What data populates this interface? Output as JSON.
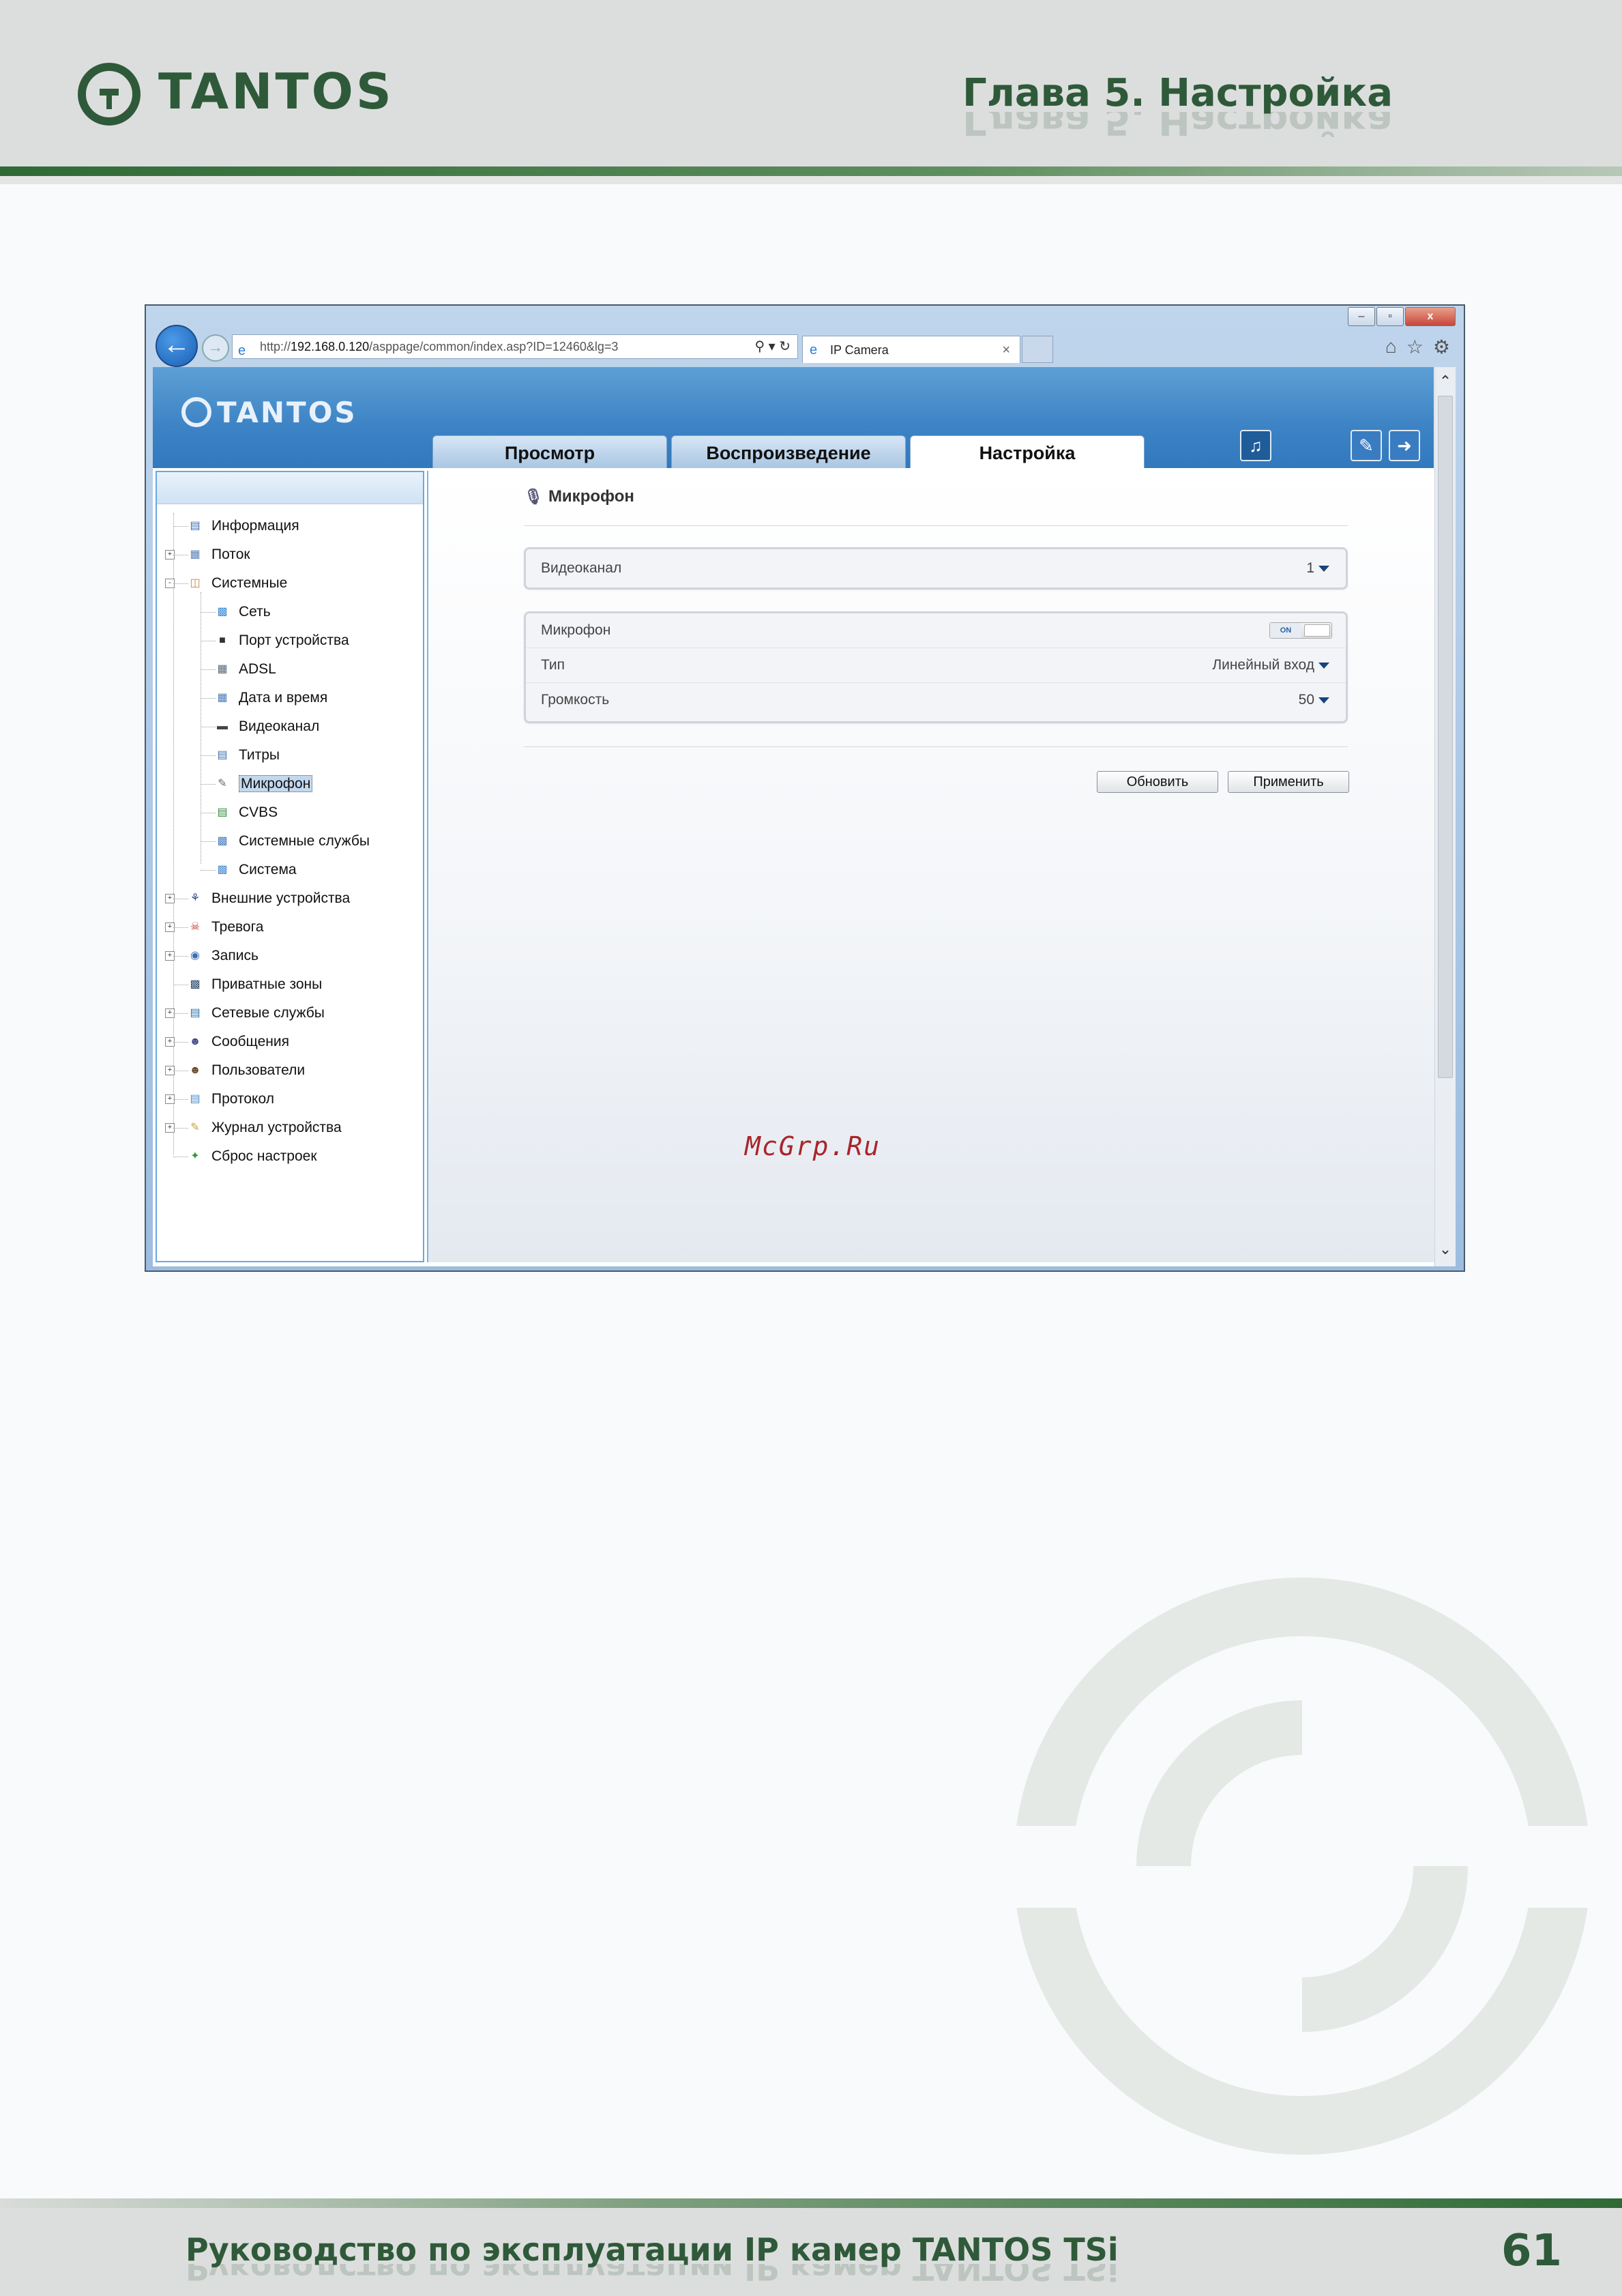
{
  "header": {
    "logo_text": "TANTOS",
    "chapter": "Глава 5. Настройка"
  },
  "browser": {
    "address_prefix": "http://",
    "address_host": "192.168.0.120",
    "address_path": "/asppage/common/index.asp?ID=12460&lg=3",
    "tab_title": "IP Camera",
    "window_buttons": [
      "–",
      "▫",
      "x"
    ]
  },
  "app": {
    "logo_text": "TANTOS",
    "tabs": [
      "Просмотр",
      "Воспроизведение",
      "Настройка"
    ],
    "active_tab": "Настройка",
    "sidebar": [
      {
        "label": "Информация",
        "icon": "info-icon",
        "level": 0,
        "expander": ""
      },
      {
        "label": "Поток",
        "icon": "stream-icon",
        "level": 0,
        "expander": "+"
      },
      {
        "label": "Системные",
        "icon": "system-folder-icon",
        "level": 0,
        "expander": "-"
      },
      {
        "label": "Сеть",
        "icon": "network-icon",
        "level": 1,
        "expander": ""
      },
      {
        "label": "Порт устройства",
        "icon": "port-icon",
        "level": 1,
        "expander": ""
      },
      {
        "label": "ADSL",
        "icon": "adsl-icon",
        "level": 1,
        "expander": ""
      },
      {
        "label": "Дата и время",
        "icon": "calendar-icon",
        "level": 1,
        "expander": ""
      },
      {
        "label": "Видеоканал",
        "icon": "camera-icon",
        "level": 1,
        "expander": ""
      },
      {
        "label": "Титры",
        "icon": "titles-icon",
        "level": 1,
        "expander": ""
      },
      {
        "label": "Микрофон",
        "icon": "microphone-icon",
        "level": 1,
        "expander": "",
        "selected": true
      },
      {
        "label": "CVBS",
        "icon": "cvbs-icon",
        "level": 1,
        "expander": ""
      },
      {
        "label": "Системные службы",
        "icon": "services-icon",
        "level": 1,
        "expander": ""
      },
      {
        "label": "Система",
        "icon": "computer-icon",
        "level": 1,
        "expander": ""
      },
      {
        "label": "Внешние устройства",
        "icon": "external-devices-icon",
        "level": 0,
        "expander": "+"
      },
      {
        "label": "Тревога",
        "icon": "alarm-icon",
        "level": 0,
        "expander": "+"
      },
      {
        "label": "Запись",
        "icon": "record-icon",
        "level": 0,
        "expander": "+"
      },
      {
        "label": "Приватные зоны",
        "icon": "privacy-icon",
        "level": 0,
        "expander": ""
      },
      {
        "label": "Сетевые службы",
        "icon": "net-services-icon",
        "level": 0,
        "expander": "+"
      },
      {
        "label": "Сообщения",
        "icon": "messages-icon",
        "level": 0,
        "expander": "+"
      },
      {
        "label": "Пользователи",
        "icon": "users-icon",
        "level": 0,
        "expander": "+"
      },
      {
        "label": "Протокол",
        "icon": "protocol-icon",
        "level": 0,
        "expander": "+"
      },
      {
        "label": "Журнал устройства",
        "icon": "log-icon",
        "level": 0,
        "expander": "+"
      },
      {
        "label": "Сброс настроек",
        "icon": "reset-icon",
        "level": 0,
        "expander": ""
      }
    ],
    "content": {
      "title": "Микрофон",
      "channel_label": "Видеоканал",
      "channel_value": "1",
      "mic_label": "Микрофон",
      "mic_toggle": "ON",
      "type_label": "Тип",
      "type_value": "Линейный вход",
      "volume_label": "Громкость",
      "volume_value": "50",
      "refresh_button": "Обновить",
      "apply_button": "Применить"
    }
  },
  "watermark": "McGrp.Ru",
  "footer": {
    "title": "Руководство по эксплуатации IP камер TANTOS TSi",
    "page_number": "61"
  },
  "colors": {
    "brand_green": "#2f5a3a",
    "app_blue": "#3c83c5",
    "select_caret": "#16447c"
  }
}
